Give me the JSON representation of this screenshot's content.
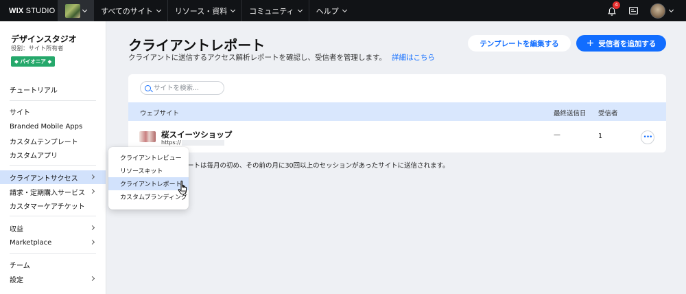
{
  "topbar": {
    "logo_wix": "WIX",
    "logo_studio": "STUDIO",
    "nav": [
      "すべてのサイト",
      "リソース・資料",
      "コミュニティ",
      "ヘルプ"
    ],
    "notification_count": "4"
  },
  "sidebar": {
    "studio_name": "デザインスタジオ",
    "studio_role": "役割：サイト所有者",
    "badge": "◆ パイオニア ◆",
    "items": [
      {
        "label": "チュートリアル"
      },
      {
        "label": "サイト"
      },
      {
        "label": "Branded Mobile Apps"
      },
      {
        "label": "カスタムテンプレート"
      },
      {
        "label": "カスタムアプリ"
      },
      {
        "label": "クライアントサクセス"
      },
      {
        "label": "請求・定期購入サービス"
      },
      {
        "label": "カスタマーケアチケット"
      },
      {
        "label": "収益"
      },
      {
        "label": "Marketplace"
      },
      {
        "label": "チーム"
      },
      {
        "label": "設定"
      }
    ]
  },
  "flyout": {
    "items": [
      "クライアントレビュー",
      "リソースキット",
      "クライアントレポート",
      "カスタムブランディング"
    ]
  },
  "main": {
    "title": "クライアントレポート",
    "subtitle": "クライアントに送信するアクセス解析レポートを確認し、受信者を管理します。",
    "details_link": "詳細はこちら",
    "edit_template_button": "テンプレートを編集する",
    "add_recipient_button": "受信者を追加する",
    "search_placeholder": "サイトを検索...",
    "table": {
      "columns": [
        "ウェブサイト",
        "最終送信日",
        "受信者"
      ],
      "rows": [
        {
          "name": "桜スイーツショップ",
          "url": "https://",
          "last_sent": "—",
          "recipients": "1"
        }
      ]
    },
    "note": "ートは毎月の初め、その前の月に30回以上のセッションがあったサイトに送信されます。"
  },
  "colors": {
    "accent": "#116dff",
    "topbar": "#111316",
    "active_bg": "#d2e2fc",
    "badge_green": "#25a86b",
    "notification_red": "#e62e2d"
  }
}
